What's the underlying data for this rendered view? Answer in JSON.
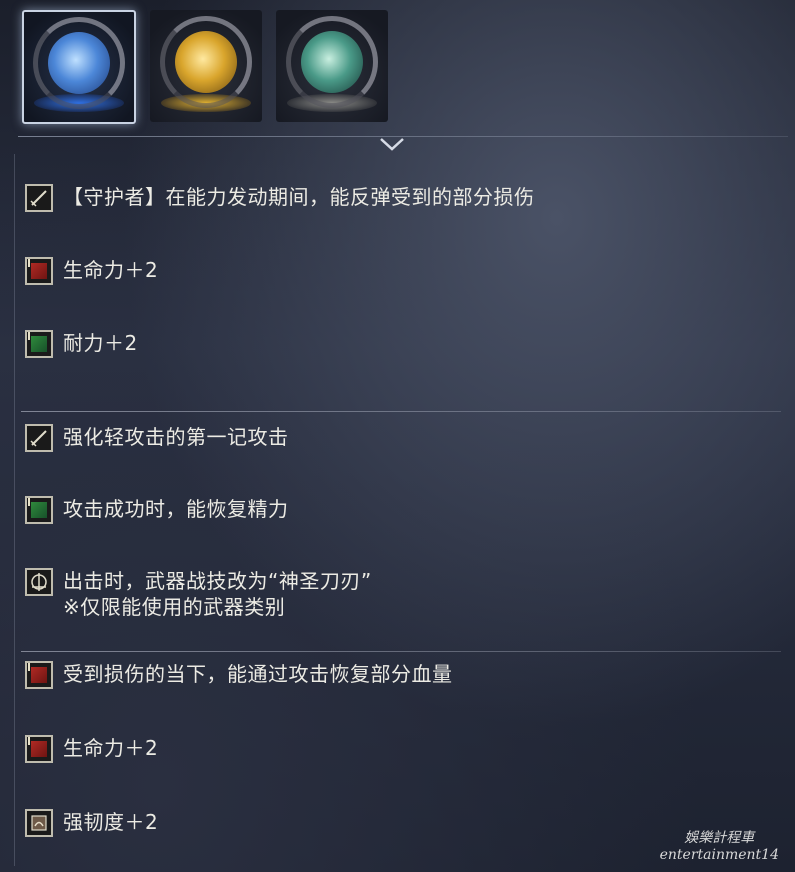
{
  "relics": [
    {
      "color": "blue",
      "selected": true
    },
    {
      "color": "gold",
      "selected": false
    },
    {
      "color": "green",
      "selected": false
    }
  ],
  "effects": [
    {
      "icon": "sword-icon",
      "text": "【守护者】在能力发动期间，能反弹受到的部分损伤"
    },
    {
      "icon": "red-stat-icon",
      "text": "生命力＋2"
    },
    {
      "icon": "green-stat-icon",
      "text": "耐力＋2"
    },
    {
      "icon": "sword-icon",
      "text": "强化轻攻击的第一记攻击"
    },
    {
      "icon": "green-stat-icon",
      "text": "攻击成功时，能恢复精力"
    },
    {
      "icon": "skill-icon",
      "text": "出击时，武器战技改为“神圣刀刃”",
      "subtext": "※仅限能使用的武器类别"
    },
    {
      "icon": "red-stat-icon",
      "text": "受到损伤的当下，能通过攻击恢复部分血量"
    },
    {
      "icon": "red-stat-icon",
      "text": "生命力＋2"
    },
    {
      "icon": "poise-icon",
      "text": "强韧度＋2"
    }
  ],
  "watermark": {
    "line1": "娛樂計程車",
    "line2": "entertainment14"
  },
  "colors": {
    "text": "#ecebe4",
    "divider": "#c8cddc",
    "selected_border": "#c9d3e3"
  }
}
